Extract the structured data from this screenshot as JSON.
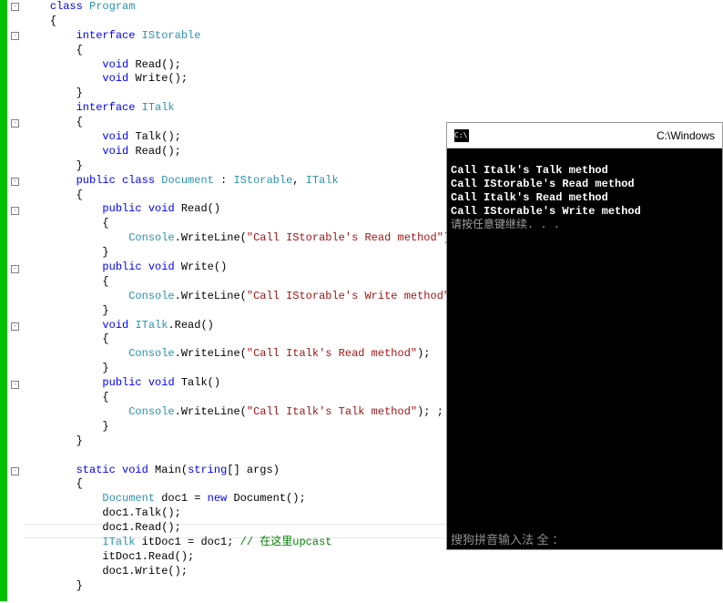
{
  "code": {
    "k_class": "class",
    "t_program": "Program",
    "br_o": "{",
    "br_c": "}",
    "k_interface": "interface",
    "t_istorable": "IStorable",
    "k_void": "void",
    "m_read": "Read",
    "m_write": "Write",
    "paren": "();",
    "t_italk": "ITalk",
    "m_talk": "Talk",
    "k_public": "public",
    "t_document": "Document",
    "colon": " : ",
    "comma": ", ",
    "paren_open": "()",
    "t_console": "Console",
    "m_writeline": ".WriteLine(",
    "q": "\"",
    "s_read": "Call IStorable's Read method",
    "close_p": ");",
    "s_write": "Call IStorable's Write method",
    "italk_read": "ITalk.Read",
    "s_italkread": "Call Italk's Read method",
    "s_italk_talk": "Call Italk's Talk method",
    "close_p2": "); ;",
    "k_static": "static",
    "m_main": "Main(",
    "k_string": "string",
    "arr": "[] args)",
    "v_doc1": " doc1 = ",
    "k_new": "new",
    "doc_ctor": " Document();",
    "l_doc1talk": "doc1.Talk();",
    "l_doc1read": "doc1.Read();",
    "v_itdoc1": " itDoc1 = doc1; ",
    "cmt": "// 在这里upcast",
    "l_itdoc1read": "itDoc1.Read();",
    "l_doc1write": "doc1.Write();"
  },
  "console": {
    "icon": "C:\\.",
    "title": "C:\\Windows",
    "l1": "Call Italk's Talk method",
    "l2": "Call IStorable's Read method",
    "l3": "Call Italk's Read method",
    "l4": "Call IStorable's Write method",
    "l5": "请按任意键继续. . .",
    "ime": "搜狗拼音输入法 全 ："
  }
}
